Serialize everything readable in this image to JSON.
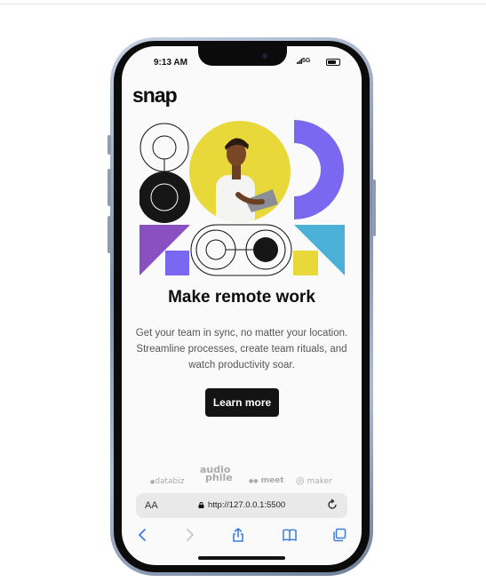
{
  "status_bar": {
    "time": "9:13 AM",
    "network": "5G"
  },
  "brand": {
    "logo": "snap"
  },
  "hero": {
    "headline": "Make remote work",
    "description": "Get your team in sync, no matter your location. Streamline processes, create team rituals, and watch productivity soar.",
    "cta_label": "Learn more"
  },
  "clients": [
    {
      "name": "databiz",
      "icon": "databiz-logo"
    },
    {
      "name": "audiophile",
      "line1": "audio",
      "line2": "phile",
      "icon": "audiophile-logo"
    },
    {
      "name": "meet",
      "icon": "meet-logo"
    },
    {
      "name": "maker",
      "icon": "maker-logo"
    }
  ],
  "browser": {
    "text_size_label": "AA",
    "url": "http://127.0.0.1:5500",
    "toolbar": [
      "back-icon",
      "forward-icon",
      "share-icon",
      "bookmarks-icon",
      "tabs-icon"
    ]
  },
  "colors": {
    "accent_dark": "#131313",
    "yellow": "#e9d83a",
    "purple": "#7a69f0",
    "violet": "#8a4fc1",
    "sky": "#4bb1d9",
    "url_bar": "#e9e9ea"
  }
}
